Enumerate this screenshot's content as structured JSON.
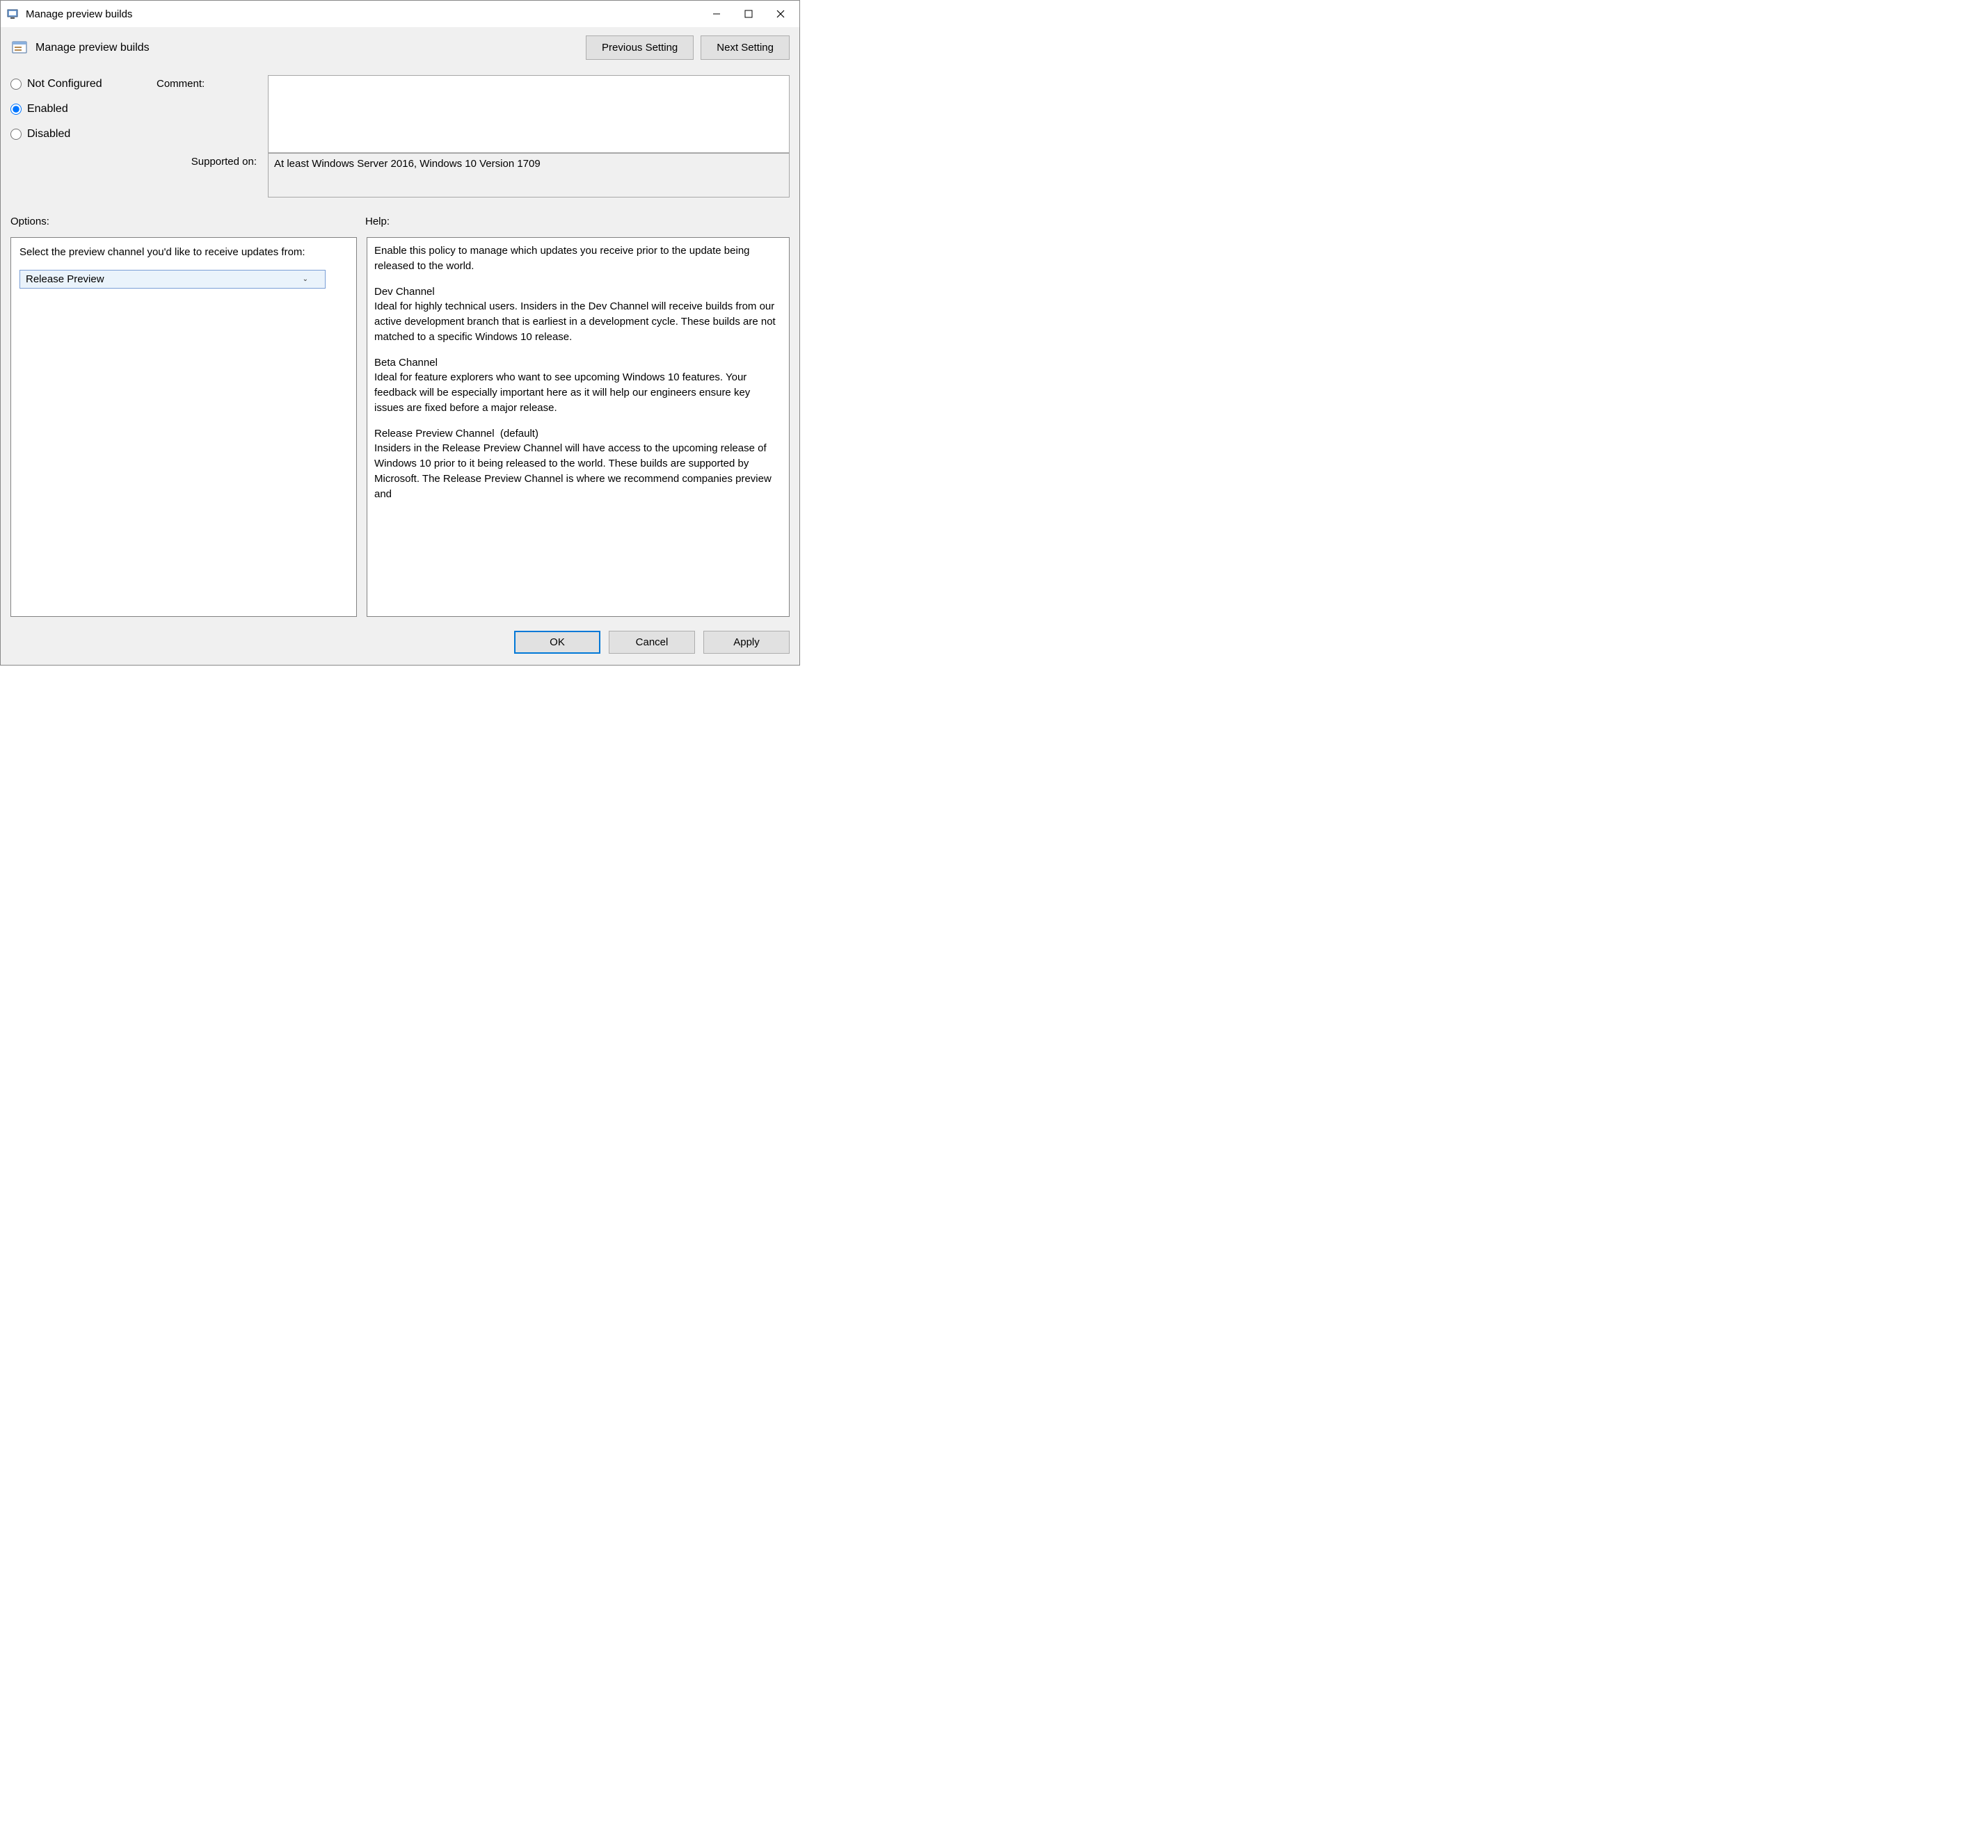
{
  "window": {
    "title": "Manage preview builds"
  },
  "header": {
    "title": "Manage preview builds",
    "prev_btn": "Previous Setting",
    "next_btn": "Next Setting"
  },
  "state": {
    "radios": {
      "not_configured": "Not Configured",
      "enabled": "Enabled",
      "disabled": "Disabled",
      "selected": "enabled"
    },
    "comment_label": "Comment:",
    "comment_value": "",
    "supported_label": "Supported on:",
    "supported_value": "At least Windows Server 2016, Windows 10 Version 1709"
  },
  "labels": {
    "options": "Options:",
    "help": "Help:"
  },
  "options": {
    "prompt": "Select the preview channel you'd like to receive updates from:",
    "selected": "Release Preview"
  },
  "help": {
    "p1": "Enable this policy to manage which updates you receive prior to the update being released to the world.",
    "p2": "Dev Channel\nIdeal for highly technical users. Insiders in the Dev Channel will receive builds from our active development branch that is earliest in a development cycle. These builds are not matched to a specific Windows 10 release.",
    "p3": "Beta Channel\nIdeal for feature explorers who want to see upcoming Windows 10 features. Your feedback will be especially important here as it will help our engineers ensure key issues are fixed before a major release.",
    "p4": "Release Preview Channel  (default)\nInsiders in the Release Preview Channel will have access to the upcoming release of Windows 10 prior to it being released to the world. These builds are supported by Microsoft. The Release Preview Channel is where we recommend companies preview and"
  },
  "footer": {
    "ok": "OK",
    "cancel": "Cancel",
    "apply": "Apply"
  }
}
